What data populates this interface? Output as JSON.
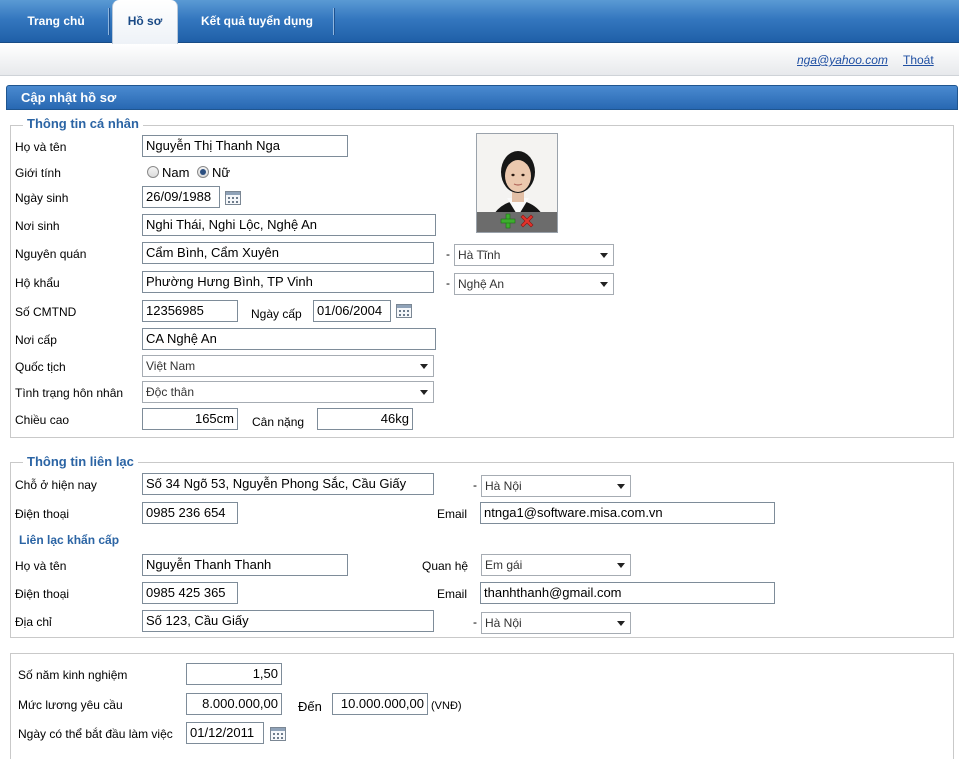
{
  "nav": {
    "tabs": [
      {
        "label": "Trang chủ",
        "active": false
      },
      {
        "label": "Hồ sơ",
        "active": true
      },
      {
        "label": "Kết quả tuyển dụng",
        "active": false
      }
    ]
  },
  "user": {
    "email": "nga@yahoo.com",
    "logout": "Thoát"
  },
  "page_title": "Cập nhật hồ sơ",
  "personal": {
    "legend": "Thông tin cá nhân",
    "full_name_label": "Họ và tên",
    "full_name": "Nguyễn Thị Thanh Nga",
    "gender_label": "Giới tính",
    "gender_male": "Nam",
    "gender_female": "Nữ",
    "gender_selected": "Nữ",
    "dob_label": "Ngày sinh",
    "dob": "26/09/1988",
    "birthplace_label": "Nơi sinh",
    "birthplace": "Nghi Thái, Nghi Lộc, Nghệ An",
    "hometown_label": "Nguyên quán",
    "hometown": "Cẩm Bình, Cẩm Xuyên",
    "hometown_province": "Hà Tĩnh",
    "household_label": "Hộ khẩu",
    "household": "Phường Hưng Bình, TP Vinh",
    "household_province": "Nghệ An",
    "id_label": "Số CMTND",
    "id_number": "12356985",
    "issue_date_label": "Ngày cấp",
    "issue_date": "01/06/2004",
    "issue_place_label": "Nơi cấp",
    "issue_place": "CA Nghệ An",
    "nationality_label": "Quốc tịch",
    "nationality": "Việt Nam",
    "marital_label": "Tình trạng hôn nhân",
    "marital": "Độc thân",
    "height_label": "Chiều cao",
    "height": "165cm",
    "weight_label": "Cân nặng",
    "weight": "46kg",
    "dash": "-"
  },
  "contact": {
    "legend": "Thông tin liên lạc",
    "address_label": "Chỗ ở hiện nay",
    "address": "Số 34 Ngõ 53, Nguyễn Phong Sắc, Cầu Giấy",
    "address_city": "Hà Nội",
    "phone_label": "Điện thoại",
    "phone": "0985 236 654",
    "email_label": "Email",
    "email": "ntnga1@software.misa.com.vn",
    "emergency_title": "Liên lạc khẩn cấp",
    "e_name_label": "Họ và tên",
    "e_name": "Nguyễn Thanh Thanh",
    "relation_label": "Quan hệ",
    "relation": "Em gái",
    "e_phone_label": "Điện thoại",
    "e_phone": "0985 425 365",
    "e_email_label": "Email",
    "e_email": "thanhthanh@gmail.com",
    "e_address_label": "Địa chỉ",
    "e_address": "Số 123, Cầu Giấy",
    "e_address_city": "Hà Nội"
  },
  "work": {
    "experience_label": "Số năm kinh nghiệm",
    "experience": "1,50",
    "salary_label": "Mức lương yêu cầu",
    "salary_from": "8.000.000,00",
    "to_label": "Đến",
    "salary_to": "10.000.000,00",
    "currency": "(VNĐ)",
    "start_label": "Ngày có thể bắt đầu làm việc",
    "start_date": "01/12/2011"
  }
}
